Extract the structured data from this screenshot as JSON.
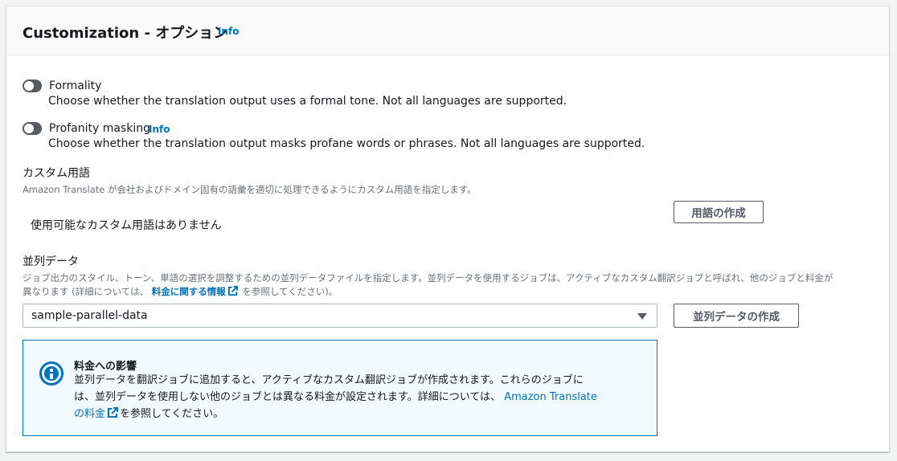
{
  "header": {
    "title": "Customization - オプション",
    "info": "Info"
  },
  "formality": {
    "label": "Formality",
    "description": "Choose whether the translation output uses a formal tone. Not all languages are supported.",
    "enabled": false
  },
  "profanity": {
    "label": "Profanity masking",
    "info": "Info",
    "description": "Choose whether the translation output masks profane words or phrases. Not all languages are supported.",
    "enabled": false
  },
  "custom_terminology": {
    "label": "カスタム用語",
    "description": "Amazon Translate が会社およびドメイン固有の語彙を適切に処理できるようにカスタム用語を指定します。",
    "empty_text": "使用可能なカスタム用語はありません",
    "create_button": "用語の作成"
  },
  "parallel_data": {
    "label": "並列データ",
    "description_line1": "ジョブ出力のスタイル、トーン、単語の選択を調整するための並列データファイルを指定します。並列データを使用するジョブは、アクティブなカスタム翻訳ジョブと呼ばれ、他のジョブと料金が",
    "description_line2_prefix": "異なります (詳細については、",
    "description_link": "料金に関する情報",
    "description_line2_suffix": "を参照してください)。",
    "selected": "sample-parallel-data",
    "create_button": "並列データの作成"
  },
  "alert": {
    "title": "料金への影響",
    "body_line1": "並列データを翻訳ジョブに追加すると、アクティブなカスタム翻訳ジョブが作成されます。これらのジョブに",
    "body_line2_prefix": "は、並列データを使用しない他のジョブとは異なる料金が設定されます。詳細については、",
    "link_part1": "Amazon Translate",
    "link_part2": "の料金",
    "body_suffix": "を参照してください。"
  },
  "colors": {
    "link": "#0073bb",
    "toggle_off": "#545b64",
    "alert_bg": "#f1faff",
    "alert_border": "#0073bb"
  }
}
